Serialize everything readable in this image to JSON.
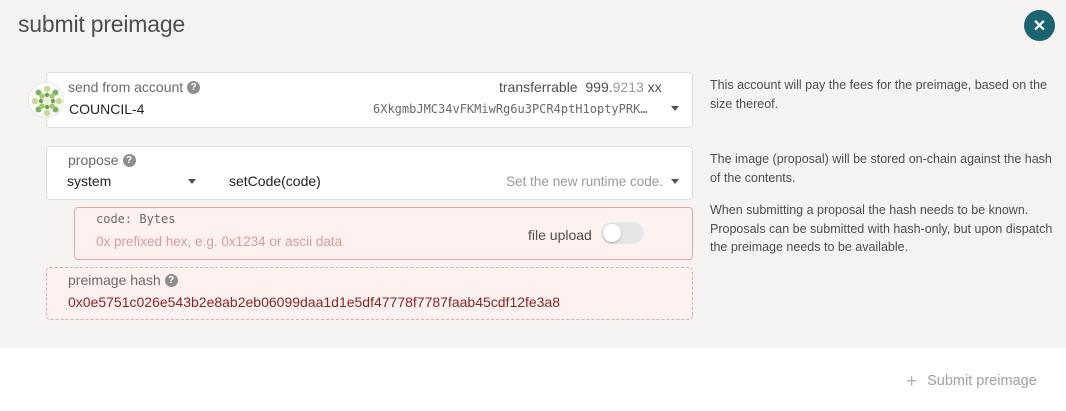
{
  "header": {
    "title": "submit preimage",
    "close_icon": "close-icon"
  },
  "account": {
    "label": "send from account",
    "name": "COUNCIL-4",
    "address": "6XkgmbJMC34vFKMiwRg6u3PCR4ptH1optyPRK…",
    "transferrable_label": "transferrable",
    "balance_main": "999.",
    "balance_decimals": "9213",
    "balance_unit": "xx",
    "help": "This account will pay the fees for the preimage, based on the size thereof."
  },
  "propose": {
    "label": "propose",
    "section": "system",
    "method": "setCode(code)",
    "method_desc": "Set the new runtime code.",
    "help_1": "The image (proposal) will be stored on-chain against the hash of the contents.",
    "help_2": "When submitting a proposal the hash needs to be known. Proposals can be submitted with hash-only, but upon dispatch the preimage needs to be available."
  },
  "code_param": {
    "label": "code: Bytes",
    "placeholder": "0x prefixed hex, e.g. 0x1234 or ascii data",
    "file_upload_label": "file upload",
    "file_upload_on": false
  },
  "preimage": {
    "label": "preimage hash",
    "hash": "0x0e5751c026e543b2e8ab2eb06099daa1d1e5df47778f7787faab45cdf12fe3a8"
  },
  "actions": {
    "submit_label": "Submit preimage",
    "submit_icon": "plus-icon"
  },
  "colors": {
    "accent": "#1b6472",
    "error_bg": "#fdf2f0",
    "error_border": "#e8a7a2",
    "hash_text": "#8e2221"
  }
}
